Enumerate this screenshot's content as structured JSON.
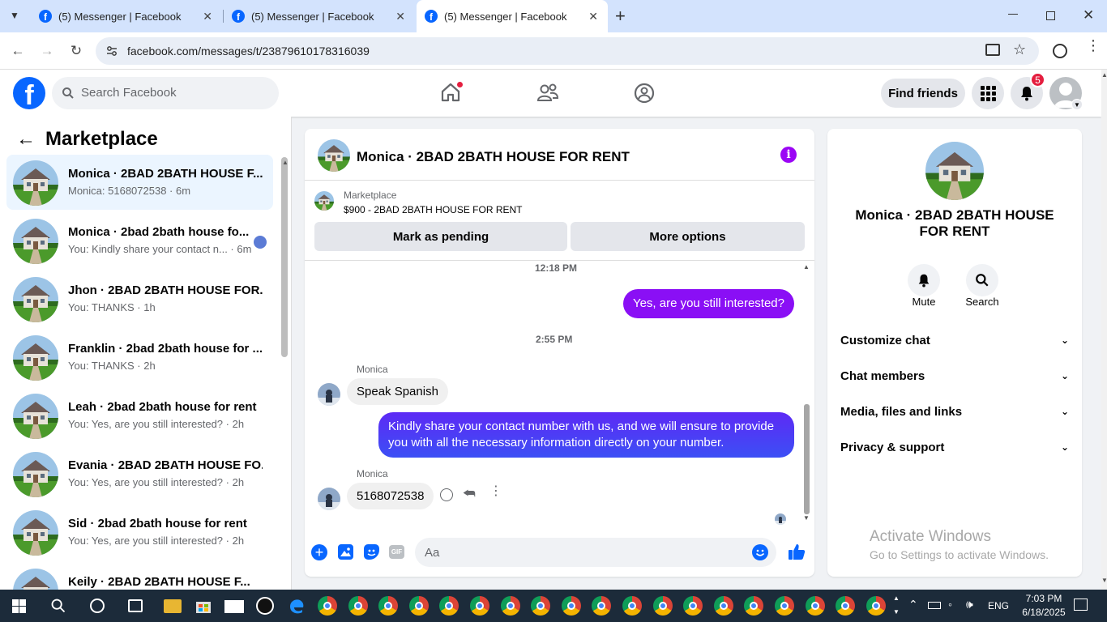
{
  "browser": {
    "tabs": [
      {
        "title": "(5) Messenger | Facebook",
        "active": false
      },
      {
        "title": "(5) Messenger | Facebook",
        "active": false
      },
      {
        "title": "(5) Messenger | Facebook",
        "active": true
      }
    ],
    "url": "facebook.com/messages/t/23879610178316039"
  },
  "fb_header": {
    "search_placeholder": "Search Facebook",
    "find_friends": "Find friends",
    "notifications_count": "5",
    "logo_letter": "f"
  },
  "left_panel": {
    "title": "Marketplace",
    "conversations": [
      {
        "name": "Monica · 2BAD 2BATH HOUSE F...",
        "preview": "Monica: 5168072538 · 6m",
        "selected": true
      },
      {
        "name": "Monica · 2bad 2bath house fo...",
        "preview": "You: Kindly share your contact n... · 6m",
        "selected": false
      },
      {
        "name": "Jhon · 2BAD 2BATH HOUSE FOR...",
        "preview": "You: THANKS · 1h",
        "selected": false
      },
      {
        "name": "Franklin · 2bad 2bath house for ...",
        "preview": "You: THANKS · 2h",
        "selected": false
      },
      {
        "name": "Leah · 2bad 2bath house for rent",
        "preview": "You: Yes, are you still interested? · 2h",
        "selected": false
      },
      {
        "name": "Evania · 2BAD 2BATH HOUSE FO...",
        "preview": "You: Yes, are you still interested? · 2h",
        "selected": false
      },
      {
        "name": "Sid · 2bad 2bath house for rent",
        "preview": "You: Yes, are you still interested? · 2h",
        "selected": false
      },
      {
        "name": "Keily · 2BAD 2BATH HOUSE F...",
        "preview": "",
        "selected": false
      }
    ]
  },
  "chat": {
    "title": "Monica · 2BAD 2BATH HOUSE FOR RENT",
    "marketplace_label": "Marketplace",
    "listing": "$900 - 2BAD 2BATH HOUSE FOR RENT",
    "mark_pending": "Mark as pending",
    "more_options": "More options",
    "time1": "12:18 PM",
    "msg_me_1": "Yes, are you still interested?",
    "time2": "2:55 PM",
    "sender1": "Monica",
    "msg_them_1": "Speak Spanish",
    "msg_me_2": "Kindly share your contact number with us, and we will ensure to provide you with all the necessary information directly on your number.",
    "sender2": "Monica",
    "msg_them_2": "5168072538",
    "input_placeholder": "Aa",
    "gif_label": "GIF"
  },
  "right_panel": {
    "name": "Monica · 2BAD 2BATH HOUSE FOR RENT",
    "mute": "Mute",
    "search": "Search",
    "sections": [
      "Customize chat",
      "Chat members",
      "Media, files and links",
      "Privacy & support"
    ],
    "activate_title": "Activate Windows",
    "activate_sub": "Go to Settings to activate Windows."
  },
  "taskbar": {
    "time": "7:03 PM",
    "date": "6/18/2025",
    "lang": "ENG"
  },
  "colors": {
    "fb_blue": "#0866ff",
    "messenger_purple": "#9b05f5",
    "bubble_grad_top": "#8a0ff5",
    "bubble_grad_bottom": "#3c4ff5",
    "notif_red": "#e41e3f"
  }
}
